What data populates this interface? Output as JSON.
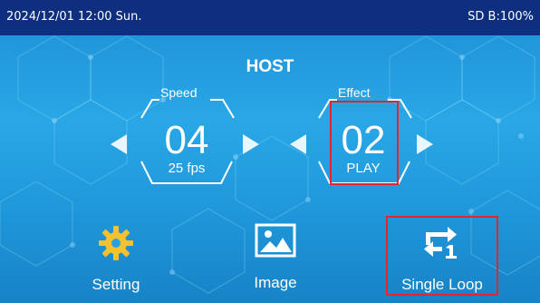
{
  "status": {
    "datetime": "2024/12/01 12:00 Sun.",
    "storage": "SD B:100%"
  },
  "title": "HOST",
  "speed": {
    "label": "Speed",
    "value": "04",
    "unit_text": "25 fps"
  },
  "effect": {
    "label": "Effect",
    "value": "02",
    "state": "PLAY"
  },
  "bottom_buttons": {
    "setting": {
      "label": "Setting",
      "icon": "gear-icon"
    },
    "image": {
      "label": "Image",
      "icon": "image-icon"
    },
    "loop": {
      "label": "Single Loop",
      "icon": "single-loop-icon"
    }
  },
  "colors": {
    "status_bar": "#0e2f80",
    "gear": "#f5c12e",
    "highlight": "#e2262b",
    "background": "#29a7e6"
  }
}
